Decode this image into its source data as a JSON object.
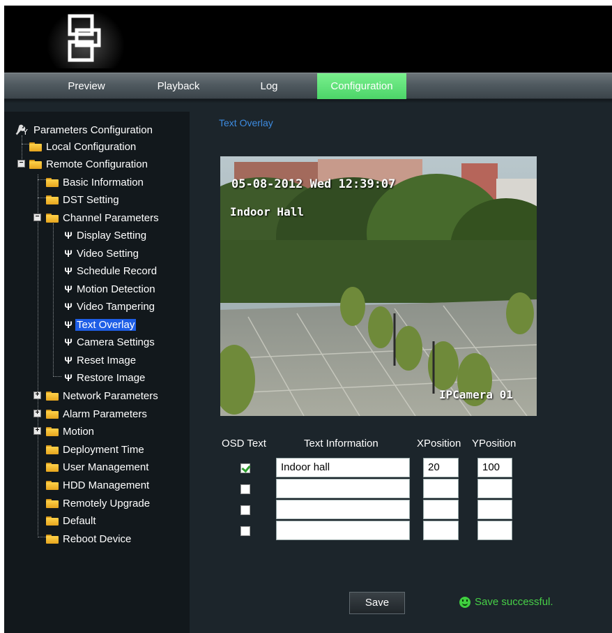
{
  "nav": {
    "tabs": [
      {
        "label": "Preview"
      },
      {
        "label": "Playback"
      },
      {
        "label": "Log"
      },
      {
        "label": "Configuration",
        "active": true
      }
    ]
  },
  "sidebar": {
    "root": "Parameters Configuration",
    "local": "Local Configuration",
    "remote": "Remote Configuration",
    "basic": "Basic Information",
    "dst": "DST Setting",
    "channel": "Channel Parameters",
    "channel_items": [
      "Display Setting",
      "Video Setting",
      "Schedule Record",
      "Motion Detection",
      "Video Tampering",
      "Text Overlay",
      "Camera Settings",
      "Reset Image",
      "Restore Image"
    ],
    "selected": "Text Overlay",
    "network": "Network Parameters",
    "alarm": "Alarm Parameters",
    "motion": "Motion",
    "deployment": "Deployment Time",
    "user": "User Management",
    "hdd": "HDD Management",
    "upgrade": "Remotely Upgrade",
    "default": "Default",
    "reboot": "Reboot Device"
  },
  "main": {
    "title": "Text Overlay",
    "video": {
      "osd_date": "05-08-2012 Wed 12:39:07",
      "osd_name": "Indoor Hall",
      "osd_camera": "IPCamera 01"
    },
    "table": {
      "headers": {
        "osd": "OSD Text",
        "info": "Text Information",
        "x": "XPosition",
        "y": "YPosition"
      },
      "rows": [
        {
          "checked": true,
          "text": "Indoor hall",
          "x": "20",
          "y": "100"
        },
        {
          "checked": false,
          "text": "",
          "x": "",
          "y": ""
        },
        {
          "checked": false,
          "text": "",
          "x": "",
          "y": ""
        },
        {
          "checked": false,
          "text": "",
          "x": "",
          "y": ""
        }
      ]
    },
    "save_label": "Save",
    "status": "Save successful."
  },
  "colors": {
    "accent_tab": "#5ee07a",
    "title_blue": "#3d8be0",
    "status_green": "#47d047",
    "selection_blue": "#1e5ee6",
    "panel_bg": "#1c252b",
    "sidebar_bg": "#12181c"
  },
  "icons": {
    "logo": "interlocked-squares-logo",
    "root": "wrench-gear-icon",
    "folder": "folder-icon",
    "leaf": "wrench-icon",
    "expand": "plus-box-icon",
    "collapse": "minus-box-icon",
    "status": "smiley-icon"
  }
}
